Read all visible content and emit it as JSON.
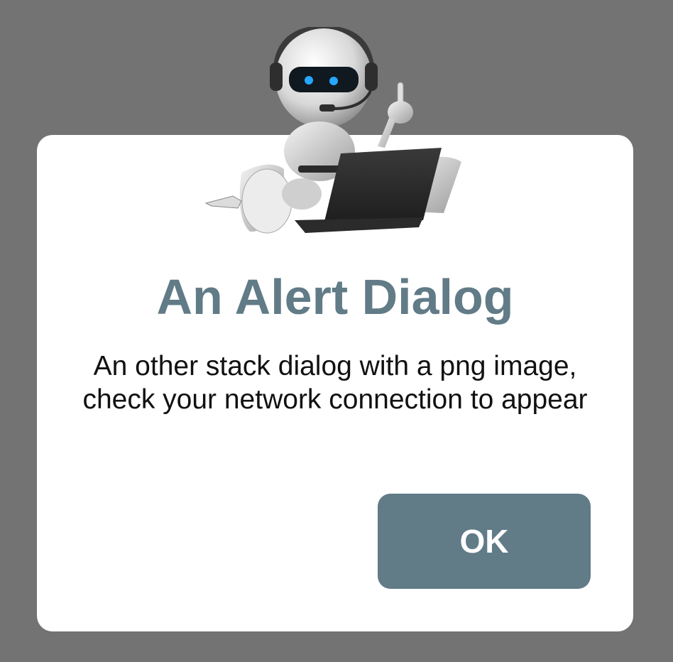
{
  "dialog": {
    "title": "An Alert Dialog",
    "message": "An other stack dialog with a png image, check your network connection to appear",
    "ok_label": "OK",
    "image": "robot-with-laptop-image"
  },
  "colors": {
    "overlay": "#737373",
    "dialog_background": "#ffffff",
    "accent": "#617b87",
    "message_text": "#111111",
    "button_text": "#ffffff"
  }
}
